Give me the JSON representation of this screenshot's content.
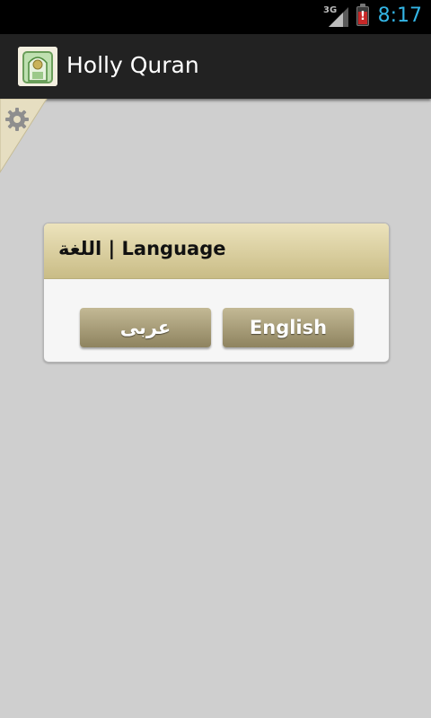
{
  "status_bar": {
    "network": "3G",
    "time": "8:17",
    "battery_level": 0.7,
    "icons": [
      "signal-icon",
      "battery-warning-icon"
    ]
  },
  "action_bar": {
    "title": "Holly Quran",
    "icon": "app-mosque-icon"
  },
  "settings": {
    "icon": "gear-icon"
  },
  "dialog": {
    "title": "اللغة | Language",
    "arabic_button": "عربى",
    "english_button": "English"
  },
  "colors": {
    "status_time": "#33b5e5",
    "action_bar_bg": "#222222",
    "background": "#cfcfcf",
    "dialog_header_top": "#ece3bc",
    "dialog_header_bottom": "#c9bc86",
    "button_top": "#c3b995",
    "button_bottom": "#8e835f"
  }
}
